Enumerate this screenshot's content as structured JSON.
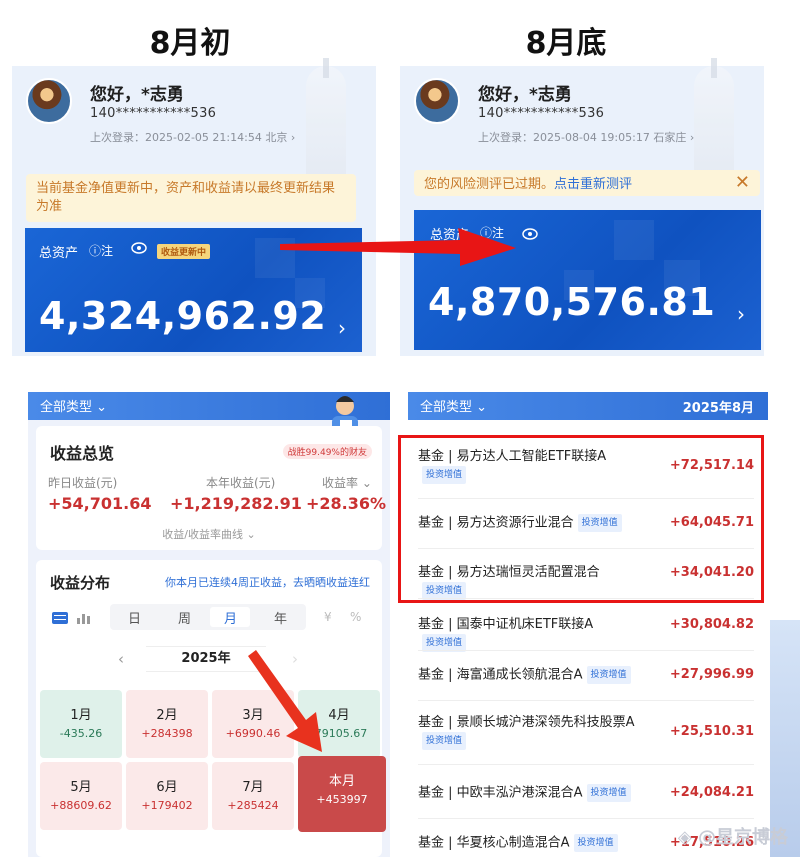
{
  "labels": {
    "left": "8月初",
    "right": "8月底"
  },
  "profile": {
    "greeting": "您好，*志勇",
    "account": "140***********536"
  },
  "left_panel": {
    "login": "上次登录：2025-02-05 21:14:54 北京 ›",
    "notice": "当前基金净值更新中，资产和收益请以最终更新结果为准",
    "assets_label": "总资产",
    "info": "ⓘ注",
    "updating": "收益更新中",
    "amount": "4,324,962.92"
  },
  "right_panel": {
    "login": "上次登录：2025-08-04 19:05:17 石家庄 ›",
    "notice_text": "您的风险测评已过期。",
    "notice_link": "点击重新测评",
    "close": "✕",
    "assets_label": "总资产",
    "info": "ⓘ注",
    "amount": "4,870,576.81"
  },
  "summary": {
    "type_filter": "全部类型 ⌄",
    "title": "收益总览",
    "beat": "战胜99.49%的财友",
    "yesterday_label": "昨日收益(元)",
    "yesterday_value": "+54,701.64",
    "year_label": "本年收益(元)",
    "year_value": "+1,219,282.91",
    "rate_label": "收益率 ⌄",
    "rate_value": "+28.36%",
    "curve_link": "收益/收益率曲线 ⌄"
  },
  "distribution": {
    "title": "收益分布",
    "streak": "你本月已连续4周正收益，去晒晒收益连红",
    "periods": [
      "日",
      "周",
      "月",
      "年"
    ],
    "active_period": "月",
    "currency": "¥",
    "percent": "%",
    "year": "2025年",
    "prev": "‹",
    "next": "›",
    "months": [
      {
        "m": "1月",
        "v": "-435.26",
        "kind": "neg"
      },
      {
        "m": "2月",
        "v": "+284398",
        "kind": "pos"
      },
      {
        "m": "3月",
        "v": "+6990.46",
        "kind": "pos"
      },
      {
        "m": "4月",
        "v": "-79105.67",
        "kind": "neg"
      },
      {
        "m": "5月",
        "v": "+88609.62",
        "kind": "pos"
      },
      {
        "m": "6月",
        "v": "+179402",
        "kind": "pos"
      },
      {
        "m": "7月",
        "v": "+285424",
        "kind": "pos"
      },
      {
        "m": "本月",
        "v": "+453997",
        "kind": "cur-m"
      }
    ]
  },
  "fund_list": {
    "type_filter": "全部类型 ⌄",
    "month": "2025年8月",
    "tag": "投资增值",
    "items": [
      {
        "name": "基金 | 易方达人工智能ETF联接A",
        "gain": "+72,517.14"
      },
      {
        "name": "基金 | 易方达资源行业混合",
        "gain": "+64,045.71"
      },
      {
        "name": "基金 | 易方达瑞恒灵活配置混合",
        "gain": "+34,041.20"
      },
      {
        "name": "基金 | 国泰中证机床ETF联接A",
        "gain": "+30,804.82"
      },
      {
        "name": "基金 | 海富通成长领航混合A",
        "gain": "+27,996.99"
      },
      {
        "name": "基金 | 景顺长城沪港深领先科技股票A",
        "gain": "+25,510.31"
      },
      {
        "name": "基金 | 中欧丰泓沪港深混合A",
        "gain": "+24,084.21"
      },
      {
        "name": "基金 | 华夏核心制造混合A",
        "gain": "+17,510.26"
      }
    ]
  },
  "watermark": "◈ @星京博格"
}
